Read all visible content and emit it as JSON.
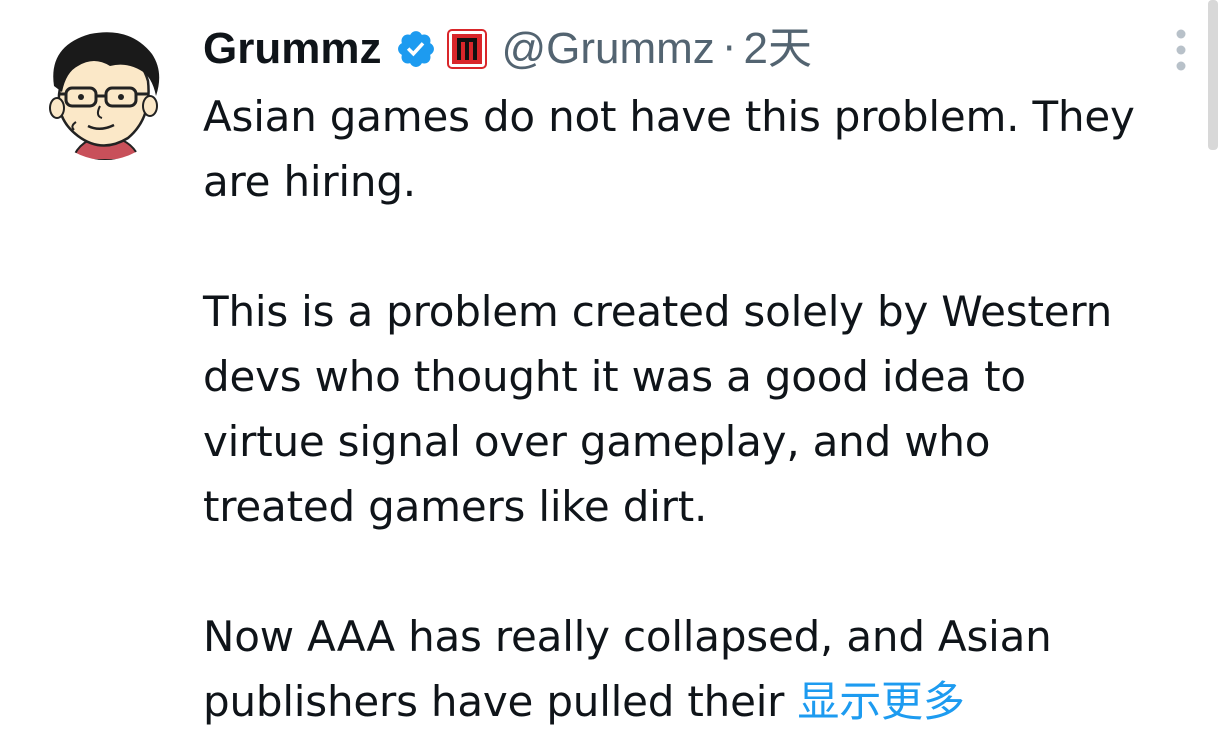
{
  "tweet": {
    "author_name": "Grummz",
    "handle": "@Grummz",
    "separator": "·",
    "time": "2天",
    "verified_icon": "verified-badge-icon",
    "org_icon": "affiliate-badge-icon",
    "more_icon": "more-options-icon",
    "avatar_icon": "cartoon-avatar",
    "body": {
      "line1": "Asian games do not have this problem. They",
      "line2": "are hiring.",
      "line3": "This is a problem created solely by Western",
      "line4": "devs who thought it was a good idea to",
      "line5": "virtue signal over gameplay, and who",
      "line6": "treated gamers like dirt.",
      "line7": "Now AAA has really collapsed, and Asian",
      "line8": "publishers have pulled their"
    },
    "show_more": "显示更多"
  },
  "colors": {
    "text": "#0f1419",
    "secondary": "#536471",
    "link": "#1d9bf0",
    "verified": "#1d9bf0",
    "badge_red": "#d9262a"
  }
}
